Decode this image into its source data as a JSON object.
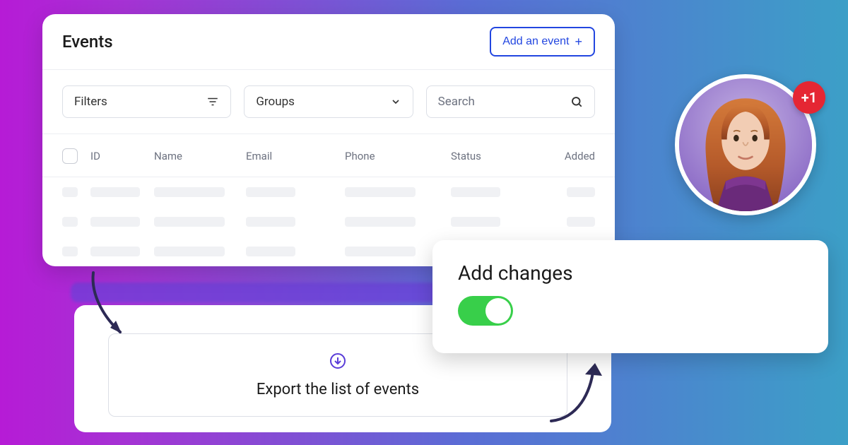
{
  "events": {
    "title": "Events",
    "add_button": "Add an event",
    "filters_label": "Filters",
    "groups_label": "Groups",
    "search_placeholder": "Search",
    "columns": {
      "id": "ID",
      "name": "Name",
      "email": "Email",
      "phone": "Phone",
      "status": "Status",
      "added": "Added"
    }
  },
  "export_box": {
    "text": "Export the list of events"
  },
  "changes": {
    "title": "Add changes",
    "toggle_on": true
  },
  "avatar": {
    "badge": "+1"
  }
}
